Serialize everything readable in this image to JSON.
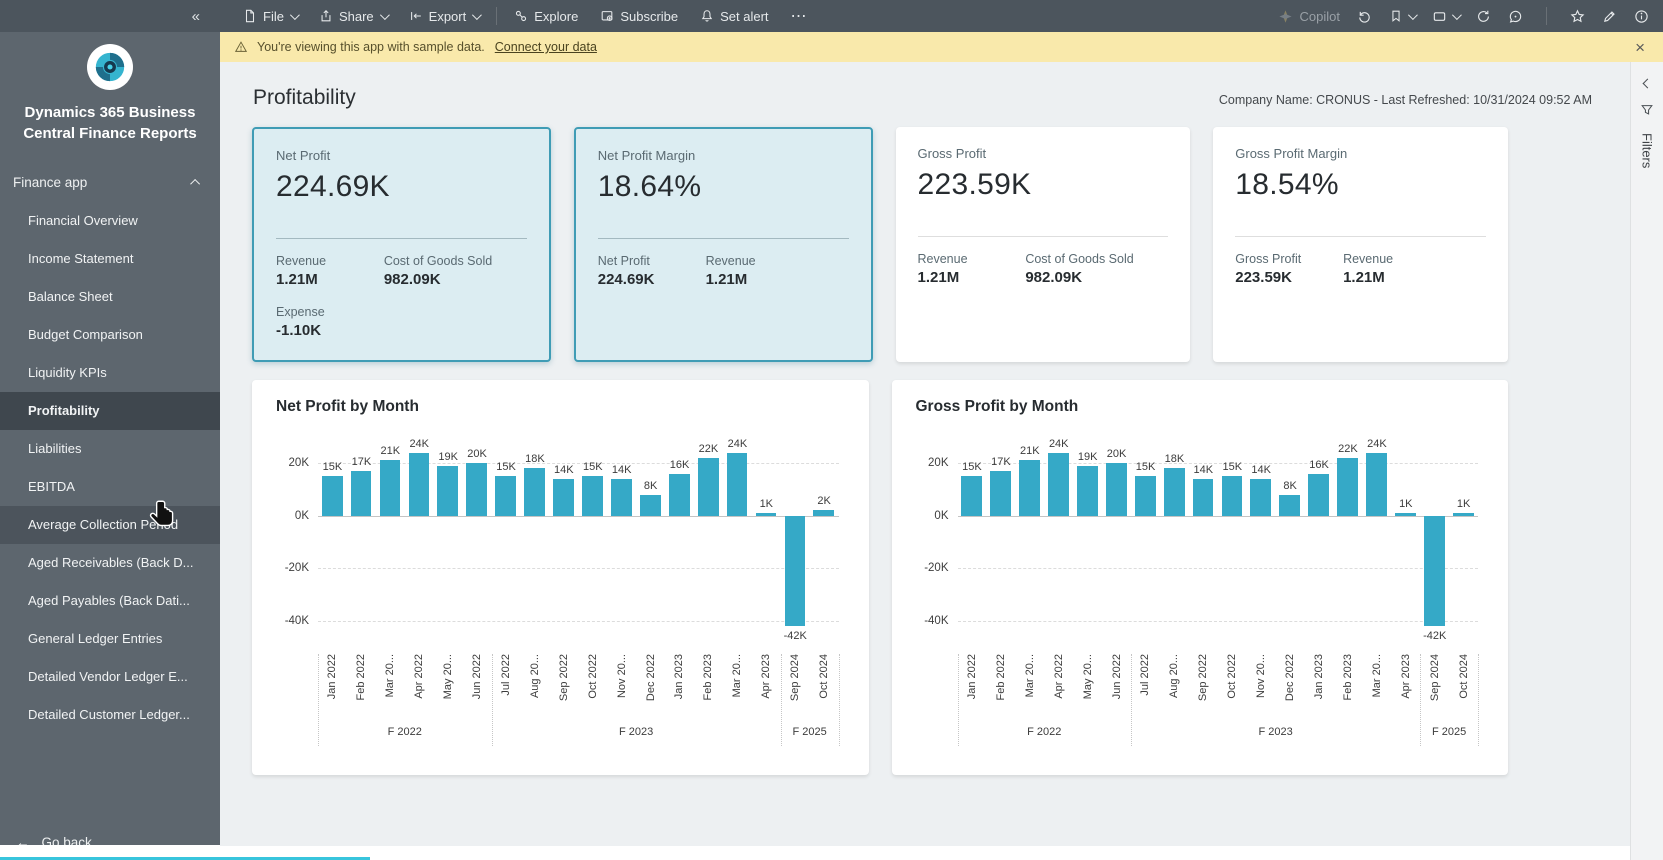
{
  "topbar": {
    "file": "File",
    "share": "Share",
    "export": "Export",
    "explore": "Explore",
    "subscribe": "Subscribe",
    "set_alert": "Set alert",
    "copilot": "Copilot"
  },
  "icons": {
    "more": "⋯",
    "close": "×",
    "collapse": "«",
    "back_arrow": "←"
  },
  "banner": {
    "warning_text": "You're viewing this app with sample data.",
    "link_text": "Connect your data"
  },
  "sidebar": {
    "app_title": "Dynamics 365 Business Central Finance Reports",
    "section_label": "Finance app",
    "items": [
      {
        "label": "Financial Overview",
        "state": "normal"
      },
      {
        "label": "Income Statement",
        "state": "normal"
      },
      {
        "label": "Balance Sheet",
        "state": "normal"
      },
      {
        "label": "Budget Comparison",
        "state": "normal"
      },
      {
        "label": "Liquidity KPIs",
        "state": "normal"
      },
      {
        "label": "Profitability",
        "state": "active"
      },
      {
        "label": "Liabilities",
        "state": "normal"
      },
      {
        "label": "EBITDA",
        "state": "normal"
      },
      {
        "label": "Average Collection Period",
        "state": "hovered"
      },
      {
        "label": "Aged Receivables (Back D...",
        "state": "normal"
      },
      {
        "label": "Aged Payables (Back Dati...",
        "state": "normal"
      },
      {
        "label": "General Ledger Entries",
        "state": "normal"
      },
      {
        "label": "Detailed Vendor Ledger E...",
        "state": "normal"
      },
      {
        "label": "Detailed Customer Ledger...",
        "state": "normal"
      }
    ],
    "go_back_label": "Go back"
  },
  "header": {
    "title": "Profitability",
    "meta": "Company Name: CRONUS - Last Refreshed: 10/31/2024 09:52 AM"
  },
  "kpi_cards": [
    {
      "title": "Net Profit",
      "value": "224.69K",
      "highlight": true,
      "details": [
        {
          "label": "Revenue",
          "value": "1.21M"
        },
        {
          "label": "Cost of Goods Sold",
          "value": "982.09K"
        },
        {
          "label": "Expense",
          "value": "-1.10K"
        }
      ]
    },
    {
      "title": "Net Profit Margin",
      "value": "18.64%",
      "highlight": true,
      "details": [
        {
          "label": "Net Profit",
          "value": "224.69K"
        },
        {
          "label": "Revenue",
          "value": "1.21M"
        }
      ]
    },
    {
      "title": "Gross Profit",
      "value": "223.59K",
      "highlight": false,
      "details": [
        {
          "label": "Revenue",
          "value": "1.21M"
        },
        {
          "label": "Cost of Goods Sold",
          "value": "982.09K"
        }
      ]
    },
    {
      "title": "Gross Profit Margin",
      "value": "18.54%",
      "highlight": false,
      "details": [
        {
          "label": "Gross Profit",
          "value": "223.59K"
        },
        {
          "label": "Revenue",
          "value": "1.21M"
        }
      ]
    }
  ],
  "filters_rail": {
    "label": "Filters"
  },
  "colors": {
    "accent_teal": "#35a9c7",
    "kpi_highlight_bg": "#dcedf2",
    "kpi_highlight_border": "#3f9cb5",
    "banner_bg": "#f9e9ab",
    "topbar_bg": "#4c555d",
    "sidebar_bg": "#5d666e"
  },
  "chart_data": [
    {
      "type": "bar",
      "title": "Net Profit by Month",
      "categories": [
        "Jan 2022",
        "Feb 2022",
        "Mar 20...",
        "Apr 2022",
        "May 20...",
        "Jun 2022",
        "Jul 2022",
        "Aug 20...",
        "Sep 2022",
        "Oct 2022",
        "Nov 20...",
        "Dec 2022",
        "Jan 2023",
        "Feb 2023",
        "Mar 20...",
        "Apr 2023",
        "Sep 2024",
        "Oct 2024"
      ],
      "values_k": [
        15,
        17,
        21,
        24,
        19,
        20,
        15,
        18,
        14,
        15,
        14,
        8,
        16,
        22,
        24,
        1,
        -42,
        2
      ],
      "bar_labels": [
        "15K",
        "17K",
        "21K",
        "24K",
        "19K",
        "20K",
        "15K",
        "18K",
        "14K",
        "15K",
        "14K",
        "8K",
        "16K",
        "22K",
        "24K",
        "1K",
        "-42K",
        "2K"
      ],
      "yticks": [
        {
          "label": "20K",
          "value_k": 20
        },
        {
          "label": "0K",
          "value_k": 0
        },
        {
          "label": "-20K",
          "value_k": -20
        },
        {
          "label": "-40K",
          "value_k": -40
        }
      ],
      "ylim_k": [
        -48,
        28
      ],
      "fiscal_groups": [
        {
          "label": "F 2022",
          "span": 6
        },
        {
          "label": "F 2023",
          "span": 10
        },
        {
          "label": "F 2025",
          "span": 2
        }
      ],
      "bar_color": "#35a9c7",
      "grid": "dashed-horizontal",
      "legend": "none"
    },
    {
      "type": "bar",
      "title": "Gross Profit by Month",
      "categories": [
        "Jan 2022",
        "Feb 2022",
        "Mar 20...",
        "Apr 2022",
        "May 20...",
        "Jun 2022",
        "Jul 2022",
        "Aug 20...",
        "Sep 2022",
        "Oct 2022",
        "Nov 20...",
        "Dec 2022",
        "Jan 2023",
        "Feb 2023",
        "Mar 20...",
        "Apr 2023",
        "Sep 2024",
        "Oct 2024"
      ],
      "values_k": [
        15,
        17,
        21,
        24,
        19,
        20,
        15,
        18,
        14,
        15,
        14,
        8,
        16,
        22,
        24,
        1,
        -42,
        1
      ],
      "bar_labels": [
        "15K",
        "17K",
        "21K",
        "24K",
        "19K",
        "20K",
        "15K",
        "18K",
        "14K",
        "15K",
        "14K",
        "8K",
        "16K",
        "22K",
        "24K",
        "1K",
        "-42K",
        "1K"
      ],
      "yticks": [
        {
          "label": "20K",
          "value_k": 20
        },
        {
          "label": "0K",
          "value_k": 0
        },
        {
          "label": "-20K",
          "value_k": -20
        },
        {
          "label": "-40K",
          "value_k": -40
        }
      ],
      "ylim_k": [
        -48,
        28
      ],
      "fiscal_groups": [
        {
          "label": "F 2022",
          "span": 6
        },
        {
          "label": "F 2023",
          "span": 10
        },
        {
          "label": "F 2025",
          "span": 2
        }
      ],
      "bar_color": "#35a9c7",
      "grid": "dashed-horizontal",
      "legend": "none"
    }
  ]
}
